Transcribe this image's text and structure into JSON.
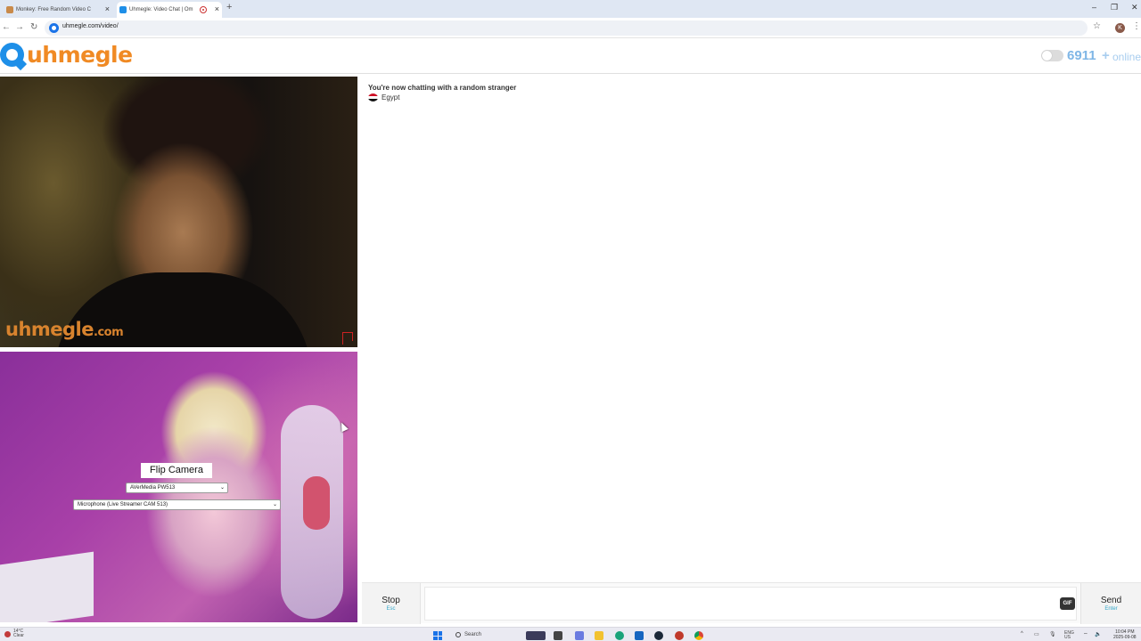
{
  "browser": {
    "tabs": [
      {
        "title": "Monkey: Free Random Video C",
        "active": false
      },
      {
        "title": "Uhmegle: Video Chat | Om",
        "active": true
      }
    ],
    "url": "uhmegle.com/video/",
    "profile_initial": "K"
  },
  "site": {
    "logo_text": "uhmegle",
    "online_count": "6911",
    "online_plus": "+",
    "online_label": "online"
  },
  "stranger_video": {
    "watermark_main": "uhmegle",
    "watermark_suffix": ".com"
  },
  "self_video": {
    "flip_camera_label": "Flip Camera",
    "camera_selected": "AVerMedia PW513",
    "microphone_selected": "Microphone (Live Streamer CAM 513)"
  },
  "chat": {
    "status_message": "You're now chatting with a random stranger",
    "country": "Egypt",
    "input_value": ""
  },
  "controls": {
    "stop_label": "Stop",
    "stop_hint": "Esc",
    "gif_label": "GIF",
    "send_label": "Send",
    "send_hint": "Enter"
  },
  "taskbar": {
    "weather_temp": "14°C",
    "weather_desc": "Clear",
    "search_label": "Search",
    "language": "ENG",
    "language_region": "US",
    "time": "10:04 PM",
    "date": "2025-09-08"
  },
  "colors": {
    "brand_orange": "#f08a24",
    "brand_blue": "#1e8fe8",
    "online_blue": "#7fb6e6",
    "hint_cyan": "#35a7c9"
  }
}
